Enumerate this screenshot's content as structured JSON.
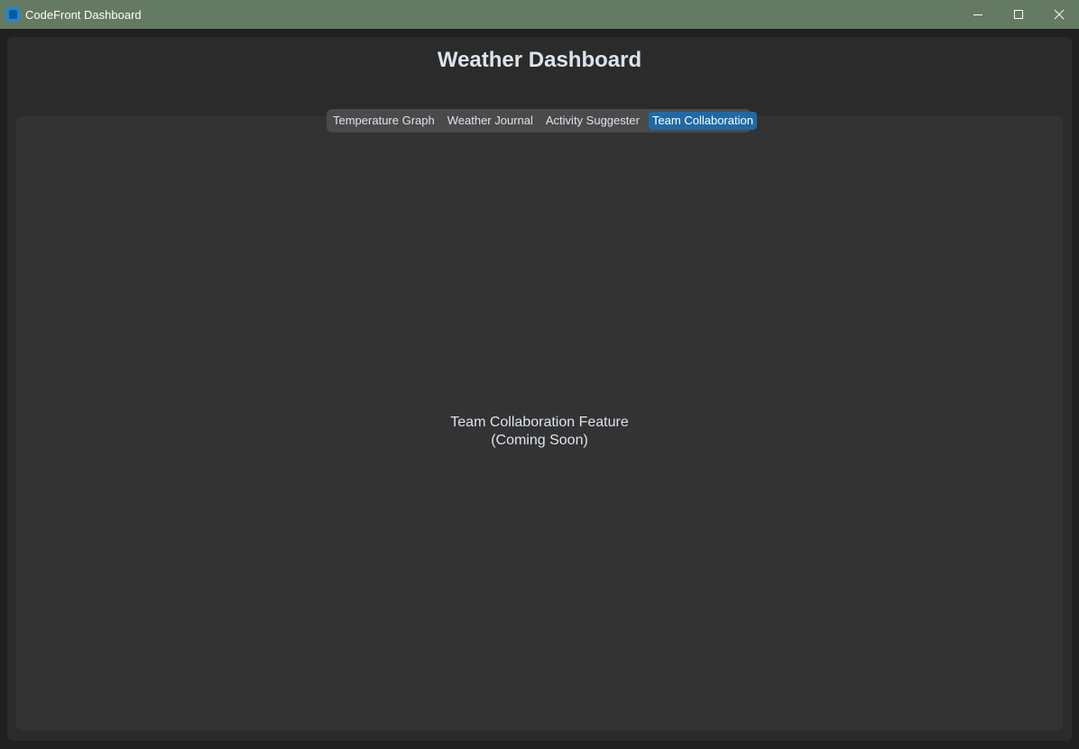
{
  "window": {
    "title": "CodeFront Dashboard",
    "controls": {
      "minimize_icon": "minimize-icon",
      "maximize_icon": "maximize-icon",
      "close_icon": "close-icon"
    },
    "titlebar_color": "#647a62"
  },
  "header": {
    "title": "Weather Dashboard"
  },
  "tabs": [
    {
      "label": "Temperature Graph",
      "active": false
    },
    {
      "label": "Weather Journal",
      "active": false
    },
    {
      "label": "Activity Suggester",
      "active": false
    },
    {
      "label": "Team Collaboration",
      "active": true
    }
  ],
  "content": {
    "line1": "Team Collaboration Feature",
    "line2": "(Coming Soon)"
  },
  "colors": {
    "accent": "#1f6aa5",
    "background": "#2b2b2b",
    "panel": "#333333",
    "text": "#dce4ee"
  }
}
